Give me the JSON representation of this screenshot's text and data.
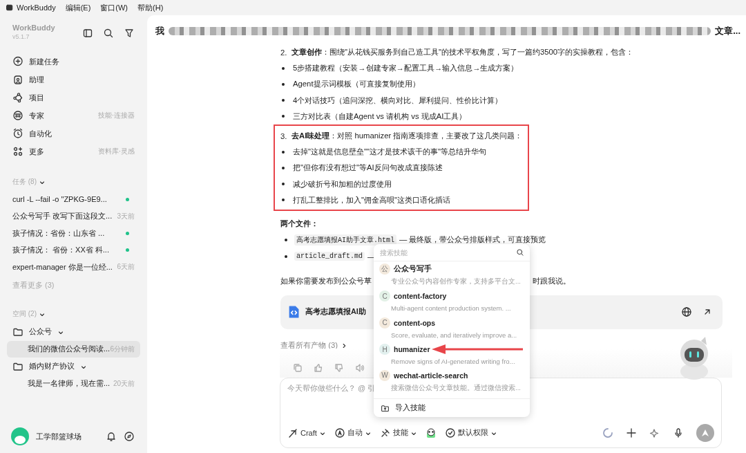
{
  "menu_bar": {
    "app": "WorkBuddy",
    "menus": [
      "编辑(E)",
      "窗口(W)",
      "帮助(H)"
    ]
  },
  "sidebar": {
    "app_name": "WorkBuddy",
    "version": "v5.1.7",
    "nav": [
      {
        "label": "新建任务"
      },
      {
        "label": "助理"
      },
      {
        "label": "项目"
      },
      {
        "label": "专家",
        "hint": "技能·连接器"
      },
      {
        "label": "自动化"
      },
      {
        "label": "更多",
        "hint": "资料库·灵感"
      }
    ],
    "tasks_header": "任务 (8)",
    "tasks": [
      {
        "kind": "dot",
        "title": "curl -L --fail -o \"ZPKG-9E9...",
        "color": "#1fc28a"
      },
      {
        "kind": "time",
        "title": "公众号写手 改写下面这段文...",
        "time": "3天前"
      },
      {
        "kind": "dot",
        "title": "孩子情况：省份：山东省 ...",
        "color": "#1fc28a"
      },
      {
        "kind": "dot",
        "title": "孩子情况： 省份：XX省 科...",
        "color": "#1fc28a"
      },
      {
        "kind": "time",
        "title": "expert-manager 你是一位经...",
        "time": "6天前"
      }
    ],
    "see_more": "查看更多 (3)",
    "spaces_header": "空间 (2)",
    "spaces": [
      {
        "name": "公众号",
        "expanded": true,
        "children": [
          {
            "title": "我们的微信公众号阅读...",
            "time": "6分钟前",
            "selected": true
          }
        ]
      },
      {
        "name": "婚内财产协议",
        "expanded": true,
        "children": [
          {
            "title": "我是一名律师，现在需...",
            "time": "20天前",
            "selected": false
          }
        ]
      }
    ],
    "user": "工学部篮球场"
  },
  "chat": {
    "title_start": "我",
    "title_end": "文章...",
    "sections": [
      {
        "highlighted": false,
        "lines": [
          {
            "kind": "numbered",
            "number": "2.",
            "text": "**文章创作**：围绕\"从花钱买服务到自己造工具\"的技术平权角度，写了一篇约3500字的实操教程，包含："
          },
          {
            "kind": "bullet",
            "text": "5步搭建教程（安装→创建专家→配置工具→输入信息→生成方案）"
          },
          {
            "kind": "bullet",
            "text": "Agent提示词模板（可直接复制使用）"
          },
          {
            "kind": "bullet",
            "text": "4个对话技巧（追问深挖、横向对比、犀利提问、性价比计算）"
          },
          {
            "kind": "bullet",
            "text": "三方对比表（自建Agent vs 请机构 vs 现成AI工具）"
          }
        ]
      },
      {
        "highlighted": true,
        "lines": [
          {
            "kind": "numbered",
            "number": "3.",
            "text": "**去AI味处理**：对照 humanizer 指南逐项排查，主要改了这几类问题："
          },
          {
            "kind": "bullet",
            "text": "去掉\"这就是信息壁垒\"\"这才是技术该干的事\"等总结升华句"
          },
          {
            "kind": "bullet",
            "text": "把\"但你有没有想过\"等AI反问句改成直接陈述"
          },
          {
            "kind": "bullet",
            "text": "减少破折号和加粗的过度使用"
          },
          {
            "kind": "bullet",
            "text": "打乱工整排比，加入\"佣金高呗\"这类口语化插话"
          }
        ]
      }
    ],
    "files_heading": "两个文件：",
    "files": [
      {
        "code": "高考志愿填报AI助手文章.html",
        "text": "— 最终版，带公众号排版样式，可直接预览"
      },
      {
        "code": "article_draft.md",
        "text": "—"
      }
    ],
    "note_left": "如果你需要发布到公众号草",
    "note_right": "时跟我说。",
    "artifact": {
      "title": "高考志愿填报AI助"
    },
    "view_all": "查看所有产物 (3)",
    "input": {
      "placeholder": "今天帮你做些什么？ @ 引",
      "tools": [
        "Craft",
        "自动",
        "技能",
        "默认权限"
      ]
    }
  },
  "skill_popup": {
    "search_placeholder": "搜索技能",
    "skills": [
      {
        "badge": "公",
        "name": "公众号写手",
        "description": "专业公众号内容创作专家，支持多平台文...",
        "color": "#f3e9dc"
      },
      {
        "badge": "C",
        "name": "content-factory",
        "description": "Multi-agent content production system. ...",
        "color": "#e3f1e7"
      },
      {
        "badge": "C",
        "name": "content-ops",
        "description": "Score, evaluate, and iteratively improve a...",
        "color": "#f3e9dc"
      },
      {
        "badge": "H",
        "name": "humanizer",
        "description": "Remove signs of AI-generated writing fro...",
        "color": "#e2f0ee"
      },
      {
        "badge": "W",
        "name": "wechat-article-search",
        "description": "搜索微信公众号文章技能。通过微信搜索...",
        "color": "#f3e9dc"
      }
    ],
    "footer": "导入技能"
  }
}
